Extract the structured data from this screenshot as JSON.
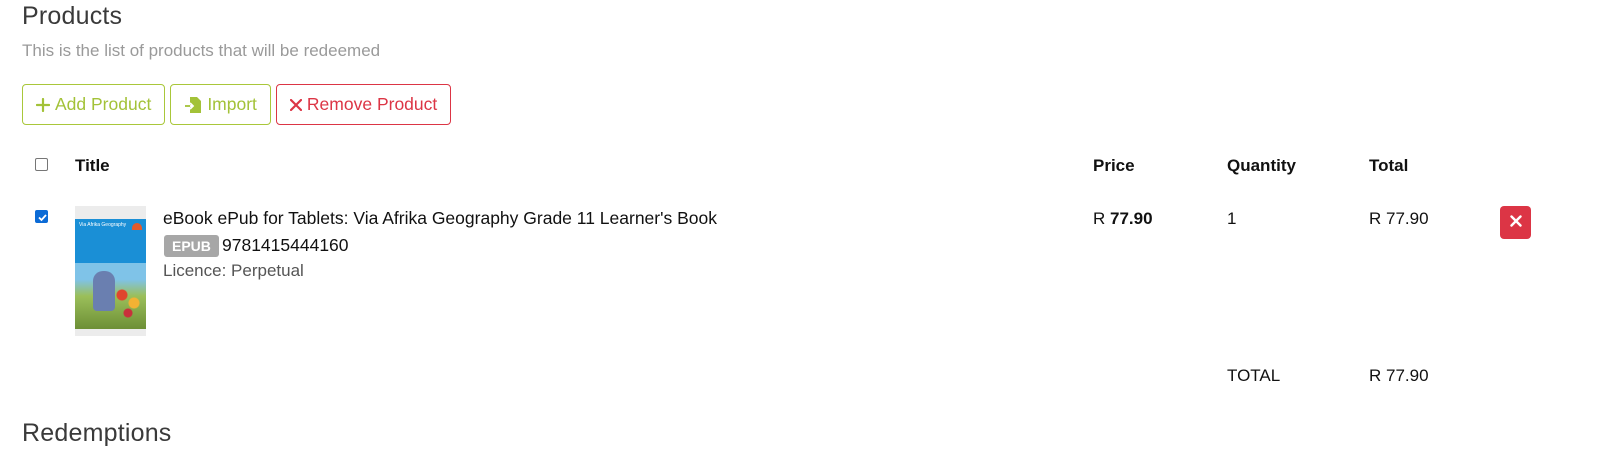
{
  "products": {
    "title": "Products",
    "subtitle": "This is the list of products that will be redeemed",
    "buttons": {
      "add": "Add Product",
      "import": "Import",
      "remove": "Remove Product"
    },
    "table": {
      "headers": {
        "title": "Title",
        "price": "Price",
        "quantity": "Quantity",
        "total": "Total"
      },
      "rows": [
        {
          "checked": true,
          "title": "eBook ePub for Tablets: Via Afrika Geography Grade 11 Learner's Book",
          "format": "EPUB",
          "isbn": "9781415444160",
          "licence": "Licence: Perpetual",
          "price_currency": "R",
          "price_amount": "77.90",
          "quantity": "1",
          "total": "R 77.90",
          "cover_text": "Via Afrika Geography"
        }
      ],
      "grand_total_label": "TOTAL",
      "grand_total_value": "R 77.90"
    }
  },
  "redemptions": {
    "title": "Redemptions"
  },
  "colors": {
    "accent_green": "#a3c238",
    "danger_red": "#dc3545",
    "checkbox_blue": "#0b6bd6",
    "badge_grey": "#a7a7a7"
  },
  "icons": {
    "add": "plus-icon",
    "import": "file-import-icon",
    "remove": "x-icon",
    "delete": "x-icon"
  }
}
